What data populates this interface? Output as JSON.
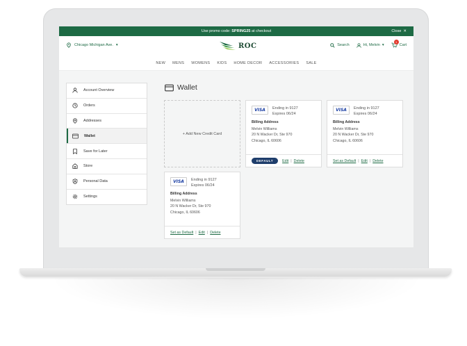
{
  "promo": {
    "prefix": "Use promo code:",
    "code": "SPRING25",
    "suffix": "at checkout",
    "close_label": "Close"
  },
  "header": {
    "location": "Chicago Michigan Ave.",
    "logo": "ROC",
    "search_label": "Search",
    "user_label": "Hi, Melvin",
    "cart_label": "Cart",
    "cart_count": "1"
  },
  "nav": [
    "NEW",
    "MENS",
    "WOMENS",
    "KIDS",
    "HOME DECOR",
    "ACCESSORIES",
    "SALE"
  ],
  "sidebar": {
    "items": [
      {
        "label": "Account Overview",
        "icon": "user-icon"
      },
      {
        "label": "Orders",
        "icon": "clock-icon"
      },
      {
        "label": "Addresses",
        "icon": "location-pin-icon"
      },
      {
        "label": "Wallet",
        "icon": "credit-card-icon",
        "active": true
      },
      {
        "label": "Save for Later",
        "icon": "bookmark-icon"
      },
      {
        "label": "Store",
        "icon": "store-icon"
      },
      {
        "label": "Personal Data",
        "icon": "shield-icon"
      },
      {
        "label": "Settings",
        "icon": "gear-icon"
      }
    ]
  },
  "wallet": {
    "title": "Wallet",
    "add_label": "+ Add New Credit Card",
    "cards": [
      {
        "brand": "VISA",
        "ending": "Ending in 9127",
        "expires": "Expires 06/24",
        "billing_label": "Billing Address",
        "name": "Melvin Williams",
        "street": "20 N Wacker Dr, Ste 970",
        "city": "Chicago, IL 60606",
        "is_default": true,
        "default_label": "DEFAULT",
        "set_default_label": "",
        "edit_label": "Edit",
        "delete_label": "Delete"
      },
      {
        "brand": "VISA",
        "ending": "Ending in 9127",
        "expires": "Expires 06/24",
        "billing_label": "Billing Address",
        "name": "Melvin Williams",
        "street": "20 N Wacker Dr, Ste 970",
        "city": "Chicago, IL 60606",
        "is_default": false,
        "default_label": "",
        "set_default_label": "Set as Default",
        "edit_label": "Edit",
        "delete_label": "Delete"
      },
      {
        "brand": "VISA",
        "ending": "Ending in 9127",
        "expires": "Expires 06/24",
        "billing_label": "Billing Address",
        "name": "Melvin Williams",
        "street": "20 N Wacker Dr, Ste 970",
        "city": "Chicago, IL 60606",
        "is_default": false,
        "default_label": "",
        "set_default_label": "Set as Default",
        "edit_label": "Edit",
        "delete_label": "Delete"
      }
    ]
  },
  "colors": {
    "brand_green": "#1d6a44",
    "default_pill": "#1e3d6b",
    "visa_blue": "#1a3ea3",
    "cart_badge": "#e23b2e"
  }
}
